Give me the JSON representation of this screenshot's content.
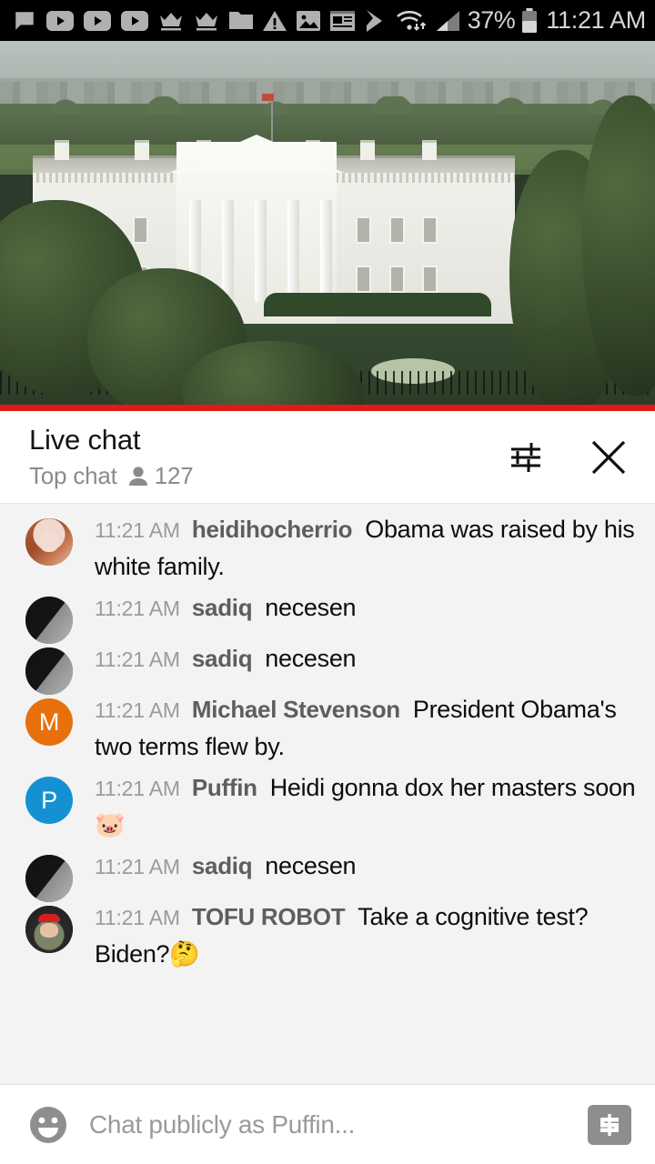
{
  "statusbar": {
    "left_icons": [
      "message-icon",
      "youtube-icon-1",
      "youtube-icon-2",
      "youtube-icon-3",
      "crown-icon-1",
      "crown-icon-2",
      "folder-icon",
      "warning-icon",
      "image-icon",
      "news-icon",
      "play-store-icon"
    ],
    "wifi_icon": "wifi-icon",
    "signal_icon": "cell-signal-icon",
    "battery_percent": "37%",
    "battery_icon": "battery-icon",
    "clock": "11:21 AM"
  },
  "video": {
    "label": "white-house-live-stream",
    "progress_color": "#e01b17"
  },
  "chat_header": {
    "title": "Live chat",
    "mode": "Top chat",
    "viewer_icon": "person-icon",
    "viewer_count": "127",
    "filter_icon": "tune-filter-icon",
    "close_icon": "close-icon"
  },
  "messages": [
    {
      "time": "11:21 AM",
      "author": "heidihocherrio",
      "text": "Obama was raised by his white family.",
      "avatar_type": "photo",
      "avatar_class": "av-heidi",
      "avatar_letter": "",
      "avatar_color": ""
    },
    {
      "time": "11:21 AM",
      "author": "sadiq",
      "text": "necesen",
      "avatar_type": "photo",
      "avatar_class": "av-sadiq",
      "avatar_letter": "",
      "avatar_color": ""
    },
    {
      "time": "11:21 AM",
      "author": "sadiq",
      "text": "necesen",
      "avatar_type": "photo",
      "avatar_class": "av-sadiq",
      "avatar_letter": "",
      "avatar_color": ""
    },
    {
      "time": "11:21 AM",
      "author": "Michael Stevenson",
      "text": "President Obama's two terms flew by.",
      "avatar_type": "letter",
      "avatar_class": "",
      "avatar_letter": "M",
      "avatar_color": "#e8700c"
    },
    {
      "time": "11:21 AM",
      "author": "Puffin",
      "text": "Heidi gonna dox her masters soon 🐷",
      "avatar_type": "letter",
      "avatar_class": "",
      "avatar_letter": "P",
      "avatar_color": "#1491d2"
    },
    {
      "time": "11:21 AM",
      "author": "sadiq",
      "text": "necesen",
      "avatar_type": "photo",
      "avatar_class": "av-sadiq",
      "avatar_letter": "",
      "avatar_color": ""
    },
    {
      "time": "11:21 AM",
      "author": "TOFU ROBOT",
      "text": "Take a cognitive test? Biden?🤔",
      "avatar_type": "photo",
      "avatar_class": "av-tofu",
      "avatar_letter": "",
      "avatar_color": ""
    }
  ],
  "input_bar": {
    "emoji_icon": "emoji-smiley-icon",
    "placeholder": "Chat publicly as Puffin...",
    "superchat_icon": "dollar-superchat-icon"
  }
}
